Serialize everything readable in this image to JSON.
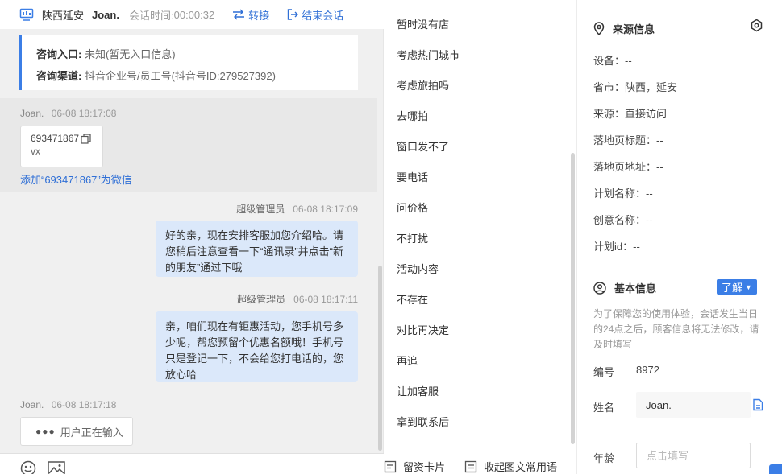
{
  "chat": {
    "header": {
      "location": "陕西延安",
      "customer_name": "Joan.",
      "session_time_label": "会话时间:",
      "session_time": "00:00:32",
      "transfer_label": "转接",
      "end_label": "结束会话"
    },
    "info": {
      "entry_key": "咨询入口:",
      "entry_value": "未知(暂无入口信息)",
      "channel_key": "咨询渠道:",
      "channel_value": "抖音企业号/员工号(抖音号ID:279527392)"
    },
    "messages": {
      "m1": {
        "sender": "Joan.",
        "time": "06-08 18:17:08",
        "contact_number": "693471867",
        "contact_type": "vx",
        "add_link": "添加“693471867”为微信"
      },
      "m2": {
        "sender": "超级管理员",
        "time": "06-08 18:17:09",
        "text": "好的亲，现在安排客服加您介绍哈。请您稍后注意查看一下“通讯录”并点击“新的朋友”通过下哦"
      },
      "m3": {
        "sender": "超级管理员",
        "time": "06-08 18:17:11",
        "text": "亲，咱们现在有钜惠活动，您手机号多少呢，帮您预留个优惠名额哦！手机号只是登记一下，不会给您打电话的，您放心哈"
      },
      "m4": {
        "sender": "Joan.",
        "time": "06-08 18:17:18",
        "typing_text": "用户正在输入"
      }
    }
  },
  "phrases": {
    "items": [
      "暂时没有店",
      "考虑热门城市",
      "考虑旅拍吗",
      "去哪拍",
      "窗口发不了",
      "要电话",
      "问价格",
      "不打扰",
      "活动内容",
      "不存在",
      "对比再决定",
      "再追",
      "让加客服",
      "拿到联系后"
    ],
    "footer_card": "留资卡片",
    "footer_collapse": "收起图文常用语"
  },
  "side": {
    "source": {
      "title": "来源信息",
      "device": "设备：--",
      "province_city": "省市：陕西，延安",
      "source": "来源：直接访问",
      "landing_title": "落地页标题：--",
      "landing_url": "落地页地址：--",
      "plan_name": "计划名称：--",
      "creative_name": "创意名称：--",
      "plan_id": "计划id：--"
    },
    "basic": {
      "title": "基本信息",
      "learn_button": "了解",
      "notice": "为了保障您的使用体验，会话发生当日的24点之后，顾客信息将无法修改，请及时填写",
      "id_label": "编号",
      "id_value": "8972",
      "name_label": "姓名",
      "name_value": "Joan.",
      "age_label": "年龄",
      "age_placeholder": "点击填写"
    }
  },
  "colors": {
    "accent": "#3b7ee6",
    "link": "#2f6fd6",
    "bubble": "#dbe8fa"
  }
}
